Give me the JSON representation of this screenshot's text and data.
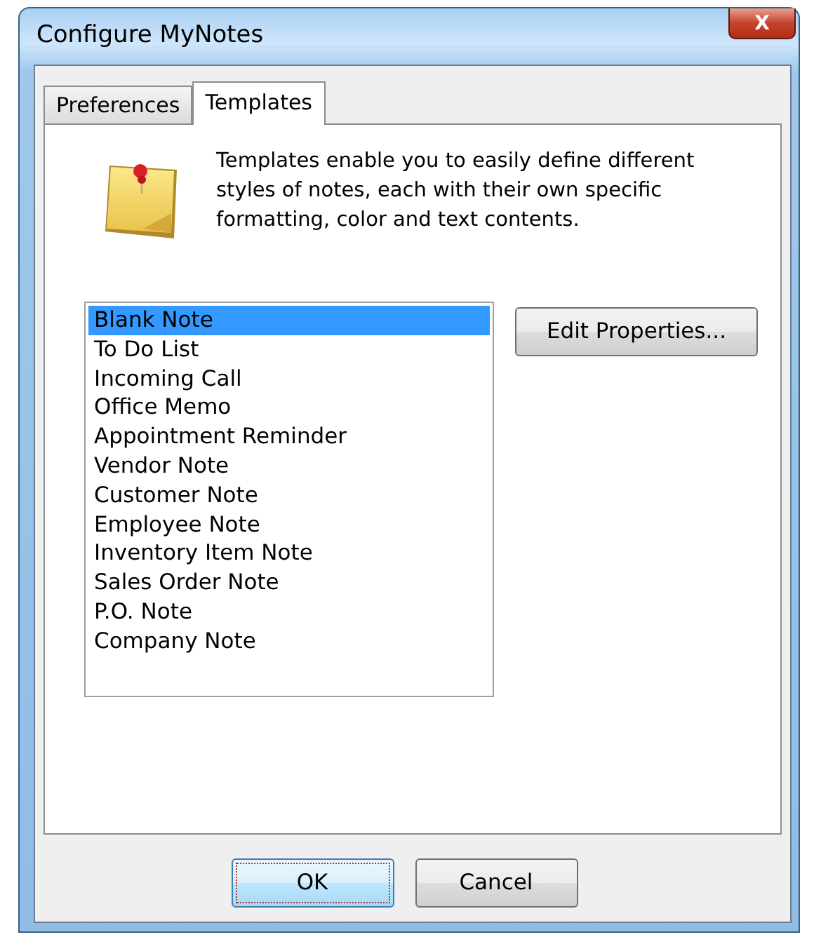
{
  "window": {
    "title": "Configure MyNotes",
    "close_label": "X"
  },
  "tabs": [
    {
      "label": "Preferences",
      "selected": false
    },
    {
      "label": "Templates",
      "selected": true
    }
  ],
  "description": "Templates enable you to easily define different styles of notes, each with their own specific formatting, color and text contents.",
  "templates": [
    {
      "label": "Blank Note",
      "selected": true
    },
    {
      "label": "To Do List",
      "selected": false
    },
    {
      "label": "Incoming Call",
      "selected": false
    },
    {
      "label": "Office Memo",
      "selected": false
    },
    {
      "label": "Appointment Reminder",
      "selected": false
    },
    {
      "label": "Vendor Note",
      "selected": false
    },
    {
      "label": "Customer Note",
      "selected": false
    },
    {
      "label": "Employee Note",
      "selected": false
    },
    {
      "label": "Inventory Item Note",
      "selected": false
    },
    {
      "label": "Sales Order Note",
      "selected": false
    },
    {
      "label": "P.O. Note",
      "selected": false
    },
    {
      "label": "Company Note",
      "selected": false
    }
  ],
  "side_button": "Edit Properties...",
  "buttons": [
    {
      "label": "OK",
      "default": true
    },
    {
      "label": "Cancel",
      "default": false
    }
  ]
}
